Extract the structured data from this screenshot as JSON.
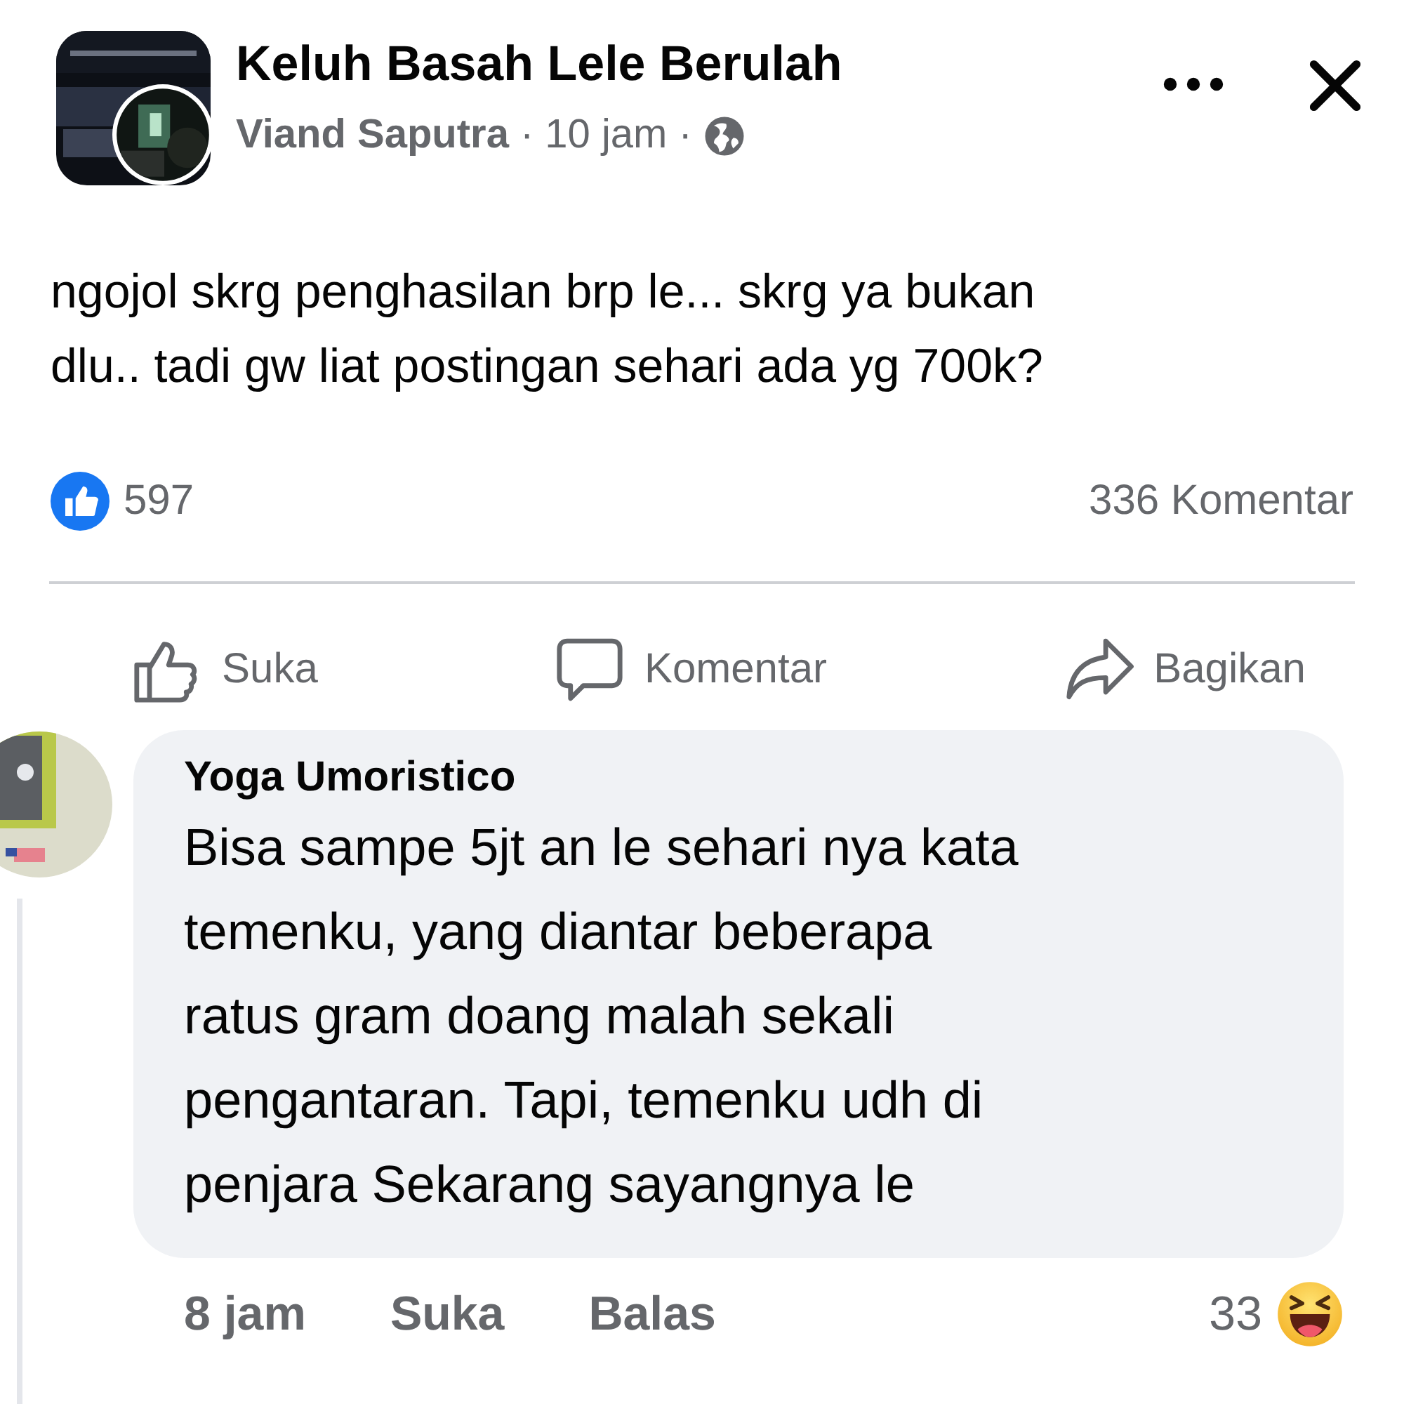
{
  "post": {
    "group": "Keluh Basah Lele Berulah",
    "author": "Viand Saputra",
    "time": "10 jam",
    "separators": [
      "·",
      "·"
    ],
    "text": "ngojol skrg penghasilan brp le... skrg ya bukan\ndlu.. tadi gw liat postingan sehari ada yg 700k?",
    "like_count": "597",
    "comment_count": "336 Komentar",
    "actions": [
      {
        "label": "Suka",
        "kind": "like"
      },
      {
        "label": "Komentar",
        "kind": "comment"
      },
      {
        "label": "Bagikan",
        "kind": "share"
      }
    ]
  },
  "comment": {
    "name": "Yoga Umoristico",
    "text": "Bisa sampe 5jt an le sehari nya kata\ntemenku, yang diantar beberapa\nratus gram doang malah sekali\npengantaran. Tapi, temenku udh di\npenjara Sekarang sayangnya le",
    "time": "8 jam",
    "actions": [
      "Suka",
      "Balas"
    ],
    "reaction_count": "33"
  }
}
